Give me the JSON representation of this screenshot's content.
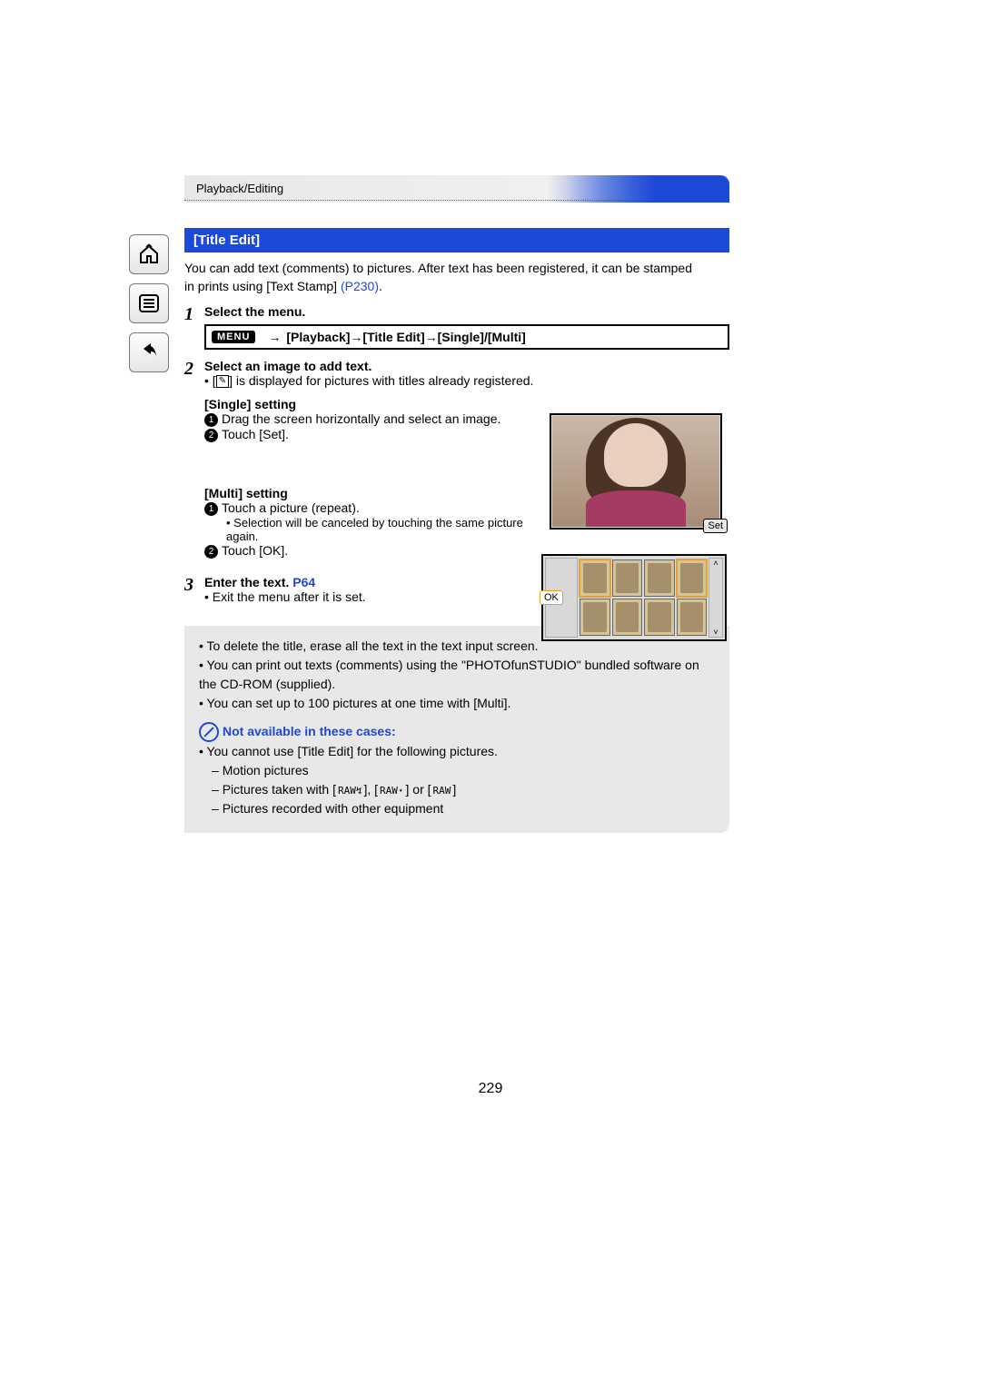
{
  "header": {
    "breadcrumb": "Playback/Editing"
  },
  "title": "[Title Edit]",
  "intro": {
    "line1": "You can add text (comments) to pictures. After text has been registered, it can be stamped",
    "line2a": "in prints using [Text Stamp] ",
    "line2_link": "(P230)",
    "line2b": "."
  },
  "steps": {
    "s1": {
      "num": "1",
      "title": "Select the menu."
    },
    "menu_chip": "MENU",
    "menu_arrow": "→",
    "menu_path": "[Playback]→[Title Edit]→[Single]/[Multi]",
    "s2": {
      "num": "2",
      "title": "Select an image to add text.",
      "note_pre": "[",
      "note_icon": "✎",
      "note_post": "] is displayed for pictures with titles already registered.",
      "single_title": "[Single] setting",
      "single_1": "Drag the screen horizontally and select an image.",
      "single_2": "Touch [Set].",
      "multi_title": "[Multi] setting",
      "multi_1": "Touch a picture (repeat).",
      "multi_1_sub": "Selection will be canceled by touching the same picture again.",
      "multi_2": "Touch [OK]."
    },
    "s3": {
      "num": "3",
      "title_a": "Enter the text. ",
      "title_link": "P64",
      "sub": "Exit the menu after it is set."
    }
  },
  "screens": {
    "set": "Set",
    "ok": "OK",
    "up": "˄",
    "down": "˅"
  },
  "notes": {
    "n1": "To delete the title, erase all the text in the text input screen.",
    "n2": "You can print out texts (comments) using the \"PHOTOfunSTUDIO\" bundled software on the CD-ROM (supplied).",
    "n3": "You can set up to 100 pictures at one time with [Multi].",
    "na_title": "Not available in these cases:",
    "na_intro": "You cannot use [Title Edit] for the following pictures.",
    "na_1": "Motion pictures",
    "na_2_pre": "Pictures taken with [",
    "na_2_a": "RAW↯",
    "na_2_mid1": "], [",
    "na_2_b": "RAW⋆",
    "na_2_mid2": "] or [",
    "na_2_c": "RAW",
    "na_2_post": "]",
    "na_3": "Pictures recorded with other equipment"
  },
  "page_number": "229"
}
